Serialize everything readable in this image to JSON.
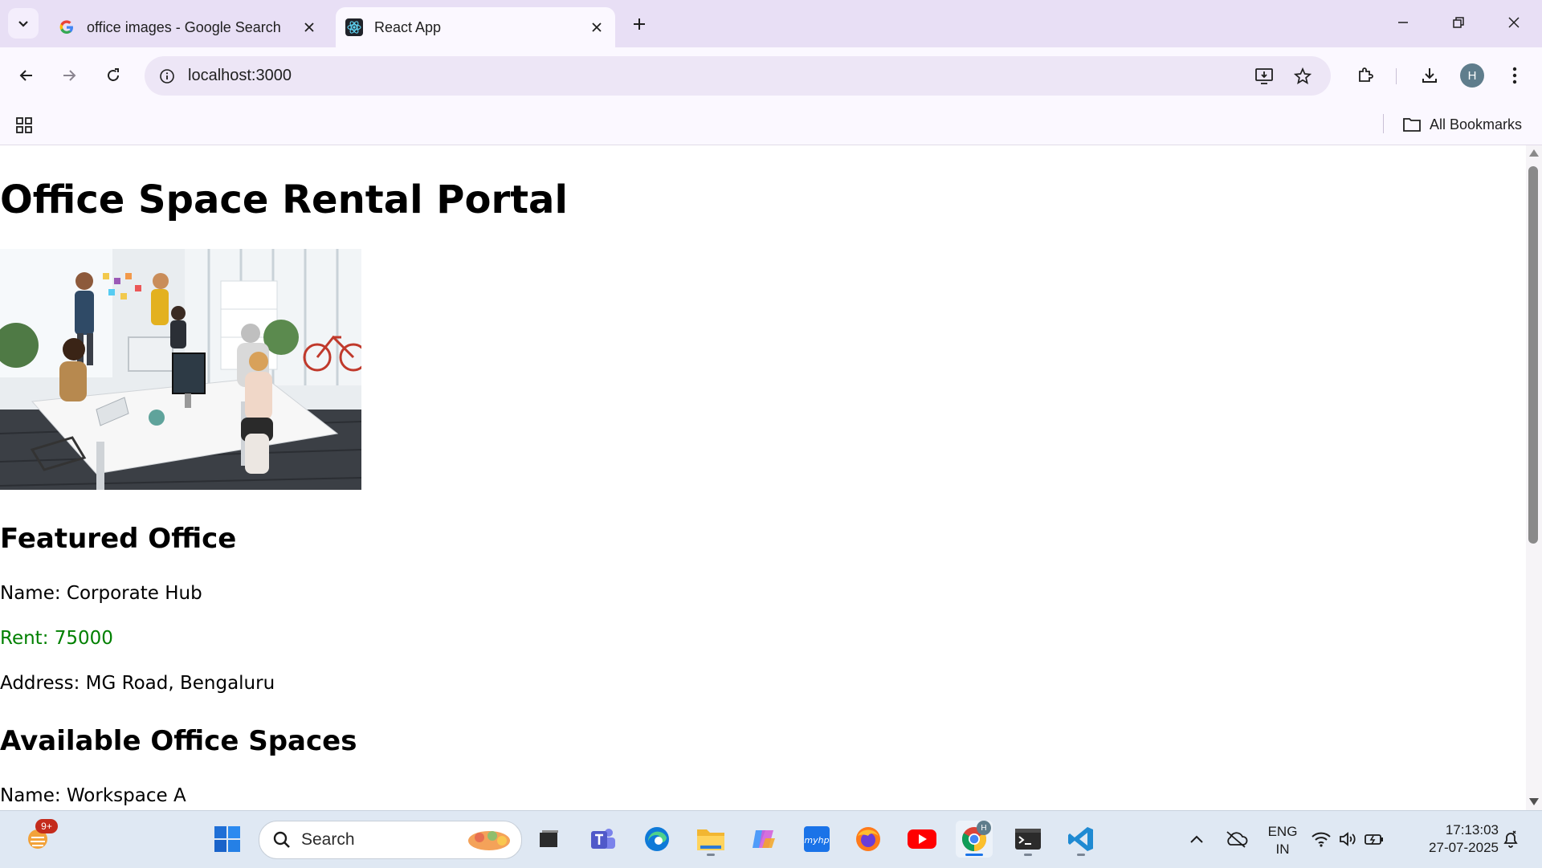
{
  "browser": {
    "tabs": [
      {
        "title": "office images - Google Search",
        "favicon": "google-g-icon"
      },
      {
        "title": "React App",
        "favicon": "react-icon"
      }
    ],
    "address": "localhost:3000",
    "bookmarks_label": "All Bookmarks",
    "profile_initial": "H"
  },
  "page": {
    "title": "Office Space Rental Portal",
    "image_alt": "office",
    "featured": {
      "heading": "Featured Office",
      "name": "Name: Corporate Hub",
      "rent": "Rent: 75000",
      "address": "Address: MG Road, Bengaluru"
    },
    "available_heading": "Available Office Spaces",
    "available": [
      {
        "name": "Name: Workspace A"
      }
    ]
  },
  "colors": {
    "rent_color": "#008000",
    "tab_strip_bg": "#e8dff5"
  },
  "taskbar": {
    "search_label": "Search",
    "notification_badge": "9+",
    "language_line1": "ENG",
    "language_line2": "IN",
    "time": "17:13:03",
    "date": "27-07-2025",
    "profile_badge": "H"
  }
}
